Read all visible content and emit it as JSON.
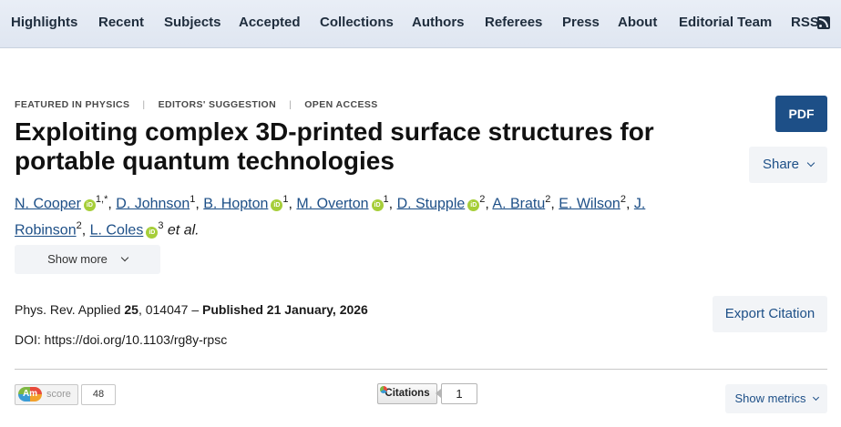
{
  "nav": {
    "items": [
      "Highlights",
      "Recent",
      "Subjects",
      "Accepted",
      "Collections",
      "Authors",
      "Referees",
      "Press",
      "About",
      "Editorial Team",
      "RSS"
    ]
  },
  "article": {
    "tags": [
      "FEATURED IN PHYSICS",
      "EDITORS' SUGGESTION",
      "OPEN ACCESS"
    ],
    "title": "Exploiting complex 3D-printed surface structures for portable quantum technologies",
    "authors": [
      {
        "name": "N. Cooper",
        "orcid": true,
        "sup": "1,*"
      },
      {
        "name": "D. Johnson",
        "orcid": false,
        "sup": "1"
      },
      {
        "name": "B. Hopton",
        "orcid": true,
        "sup": "1"
      },
      {
        "name": "M. Overton",
        "orcid": true,
        "sup": "1"
      },
      {
        "name": "D. Stupple",
        "orcid": true,
        "sup": "2"
      },
      {
        "name": "A. Bratu",
        "orcid": false,
        "sup": "2"
      },
      {
        "name": "E. Wilson",
        "orcid": false,
        "sup": "2"
      },
      {
        "name": "J. Robinson",
        "orcid": false,
        "sup": "2"
      },
      {
        "name": "L. Coles",
        "orcid": true,
        "sup": "3"
      }
    ],
    "et_al": "et al.",
    "orcid_icon_text": "iD",
    "show_more_label": "Show more",
    "journal": "Phys. Rev. Applied",
    "volume": "25",
    "article_number": ", 014047 – ",
    "published": "Published 21 January, 2026",
    "doi": "DOI: https://doi.org/10.1103/rg8y-rpsc"
  },
  "actions": {
    "pdf_label": "PDF",
    "share_label": "Share",
    "export_label": "Export Citation",
    "show_metrics_label": "Show metrics"
  },
  "metrics": {
    "altmetric_logo": "Am",
    "altmetric_score_label": "score",
    "altmetric_score": "48",
    "citations_label": "Citations",
    "citations_count": "1"
  },
  "colors": {
    "accent": "#1d4f87",
    "orcid": "#a6ce39",
    "nav_bg": "#e4eaf3"
  }
}
